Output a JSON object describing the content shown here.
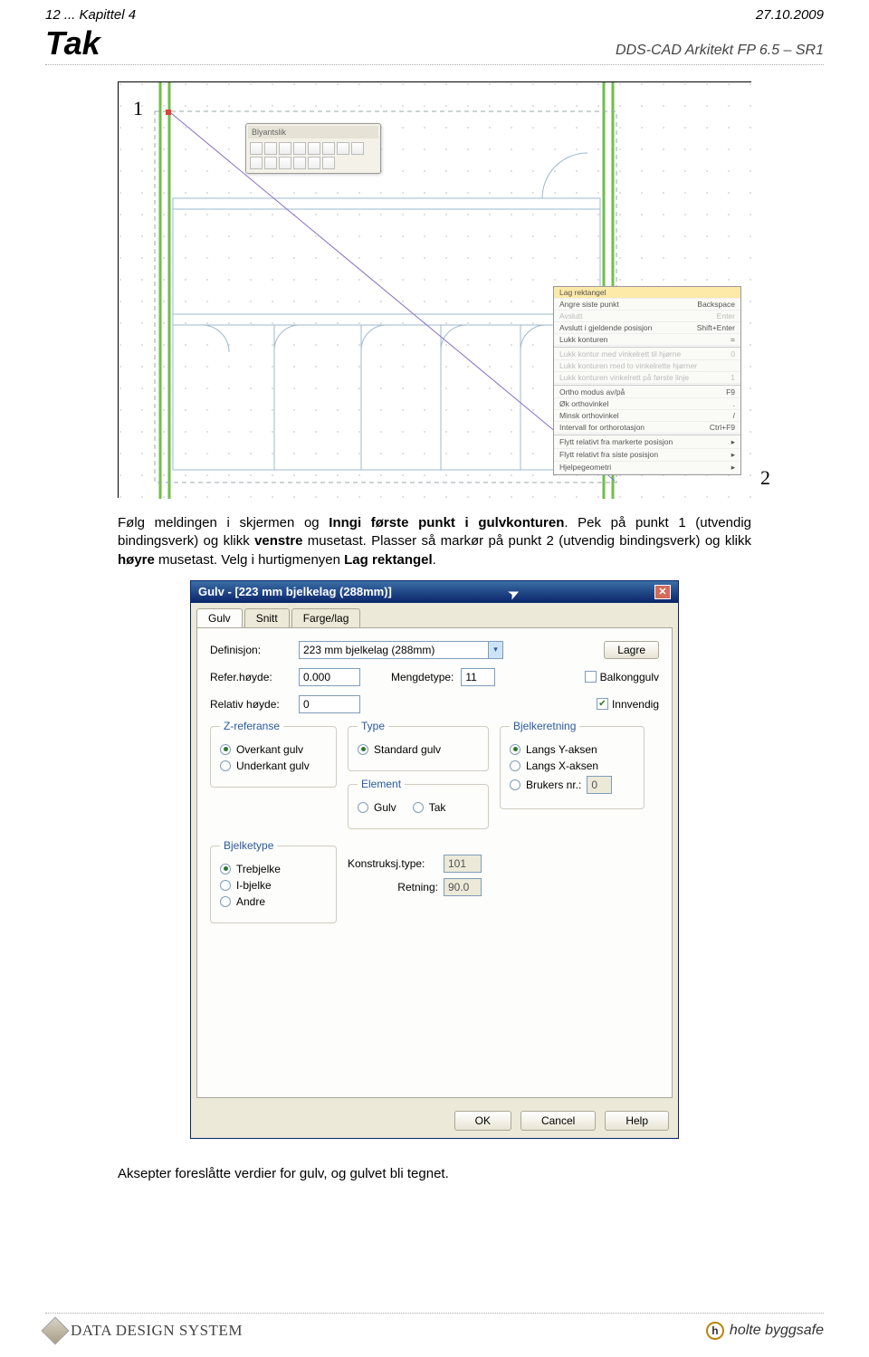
{
  "header": {
    "left": "12 ... Kapittel 4",
    "right": "27.10.2009",
    "tak": "Tak",
    "dds": "DDS-CAD Arkitekt FP 6.5 – SR1"
  },
  "drawing": {
    "label1": "1",
    "label2": "2",
    "toolbar_title": "Blyantslik"
  },
  "contextMenu": {
    "items": [
      {
        "l": "Lag rektangel",
        "r": "",
        "hl": true
      },
      {
        "l": "Angre siste punkt",
        "r": "Backspace"
      },
      {
        "l": "Avslutt",
        "r": "Enter",
        "dim": true
      },
      {
        "l": "Avslutt i gjeldende posisjon",
        "r": "Shift+Enter"
      },
      {
        "l": "Lukk konturen",
        "r": "="
      },
      {
        "l": "Lukk kontur med vinkelrett til hjørne",
        "r": "0",
        "dim": true
      },
      {
        "l": "Lukk konturen med to vinkelrette hjørner",
        "r": "",
        "dim": true
      },
      {
        "l": "Lukk konturen vinkelrett på første linje",
        "r": "1",
        "dim": true
      },
      {
        "l": "Ortho modus av/på",
        "r": "F9"
      },
      {
        "l": "Øk orthovinkel",
        "r": "."
      },
      {
        "l": "Minsk orthovinkel",
        "r": "/"
      },
      {
        "l": "Intervall for orthorotasjon",
        "r": "Ctrl+F9"
      },
      {
        "l": "Flytt relativt fra markerte posisjon",
        "r": "▸"
      },
      {
        "l": "Flytt relativt fra siste posisjon",
        "r": "▸"
      },
      {
        "l": "Hjelpegeometri",
        "r": "▸"
      }
    ]
  },
  "bodyText": {
    "p1a": "Følg meldingen i skjermen og ",
    "p1b": "Inngi første punkt i gulvkonturen",
    "p1c": ". Pek på punkt 1 (utvendig bindingsverk) og klikk ",
    "p1d": "venstre",
    "p1e": " musetast. Plasser så markør på punkt 2 (utvendig bindingsverk) og klikk ",
    "p1f": "høyre",
    "p1g": " musetast. Velg i hurtigmenyen ",
    "p1h": "Lag rektangel",
    "p1i": "."
  },
  "dialog": {
    "title": "Gulv - [223 mm bjelkelag (288mm)]",
    "tabs": [
      "Gulv",
      "Snitt",
      "Farge/lag"
    ],
    "definisjon_label": "Definisjon:",
    "definisjon_value": "223 mm bjelkelag (288mm)",
    "lagre": "Lagre",
    "refer_label": "Refer.høyde:",
    "refer_value": "0.000",
    "mengdetype_label": "Mengdetype:",
    "mengdetype_value": "11",
    "balkonggulv": "Balkonggulv",
    "innvendig": "Innvendig",
    "relativ_label": "Relativ høyde:",
    "relativ_value": "0",
    "zref": {
      "legend": "Z-referanse",
      "opt1": "Overkant gulv",
      "opt2": "Underkant gulv"
    },
    "type": {
      "legend": "Type",
      "opt1": "Standard gulv"
    },
    "element": {
      "legend": "Element",
      "opt1": "Gulv",
      "opt2": "Tak"
    },
    "bjelkeretning": {
      "legend": "Bjelkeretning",
      "opt1": "Langs Y-aksen",
      "opt2": "Langs X-aksen",
      "opt3": "Brukers nr.:",
      "val": "0"
    },
    "bjelketype": {
      "legend": "Bjelketype",
      "opt1": "Trebjelke",
      "opt2": "I-bjelke",
      "opt3": "Andre"
    },
    "konstr_label": "Konstruksj.type:",
    "konstr_value": "101",
    "retning_label": "Retning:",
    "retning_value": "90.0",
    "ok": "OK",
    "cancel": "Cancel",
    "help": "Help"
  },
  "afterText": "Aksepter foreslåtte verdier for gulv, og gulvet bli tegnet.",
  "footer": {
    "dds": "DATA DESIGN SYSTEM",
    "holte": "holte byggsafe"
  }
}
